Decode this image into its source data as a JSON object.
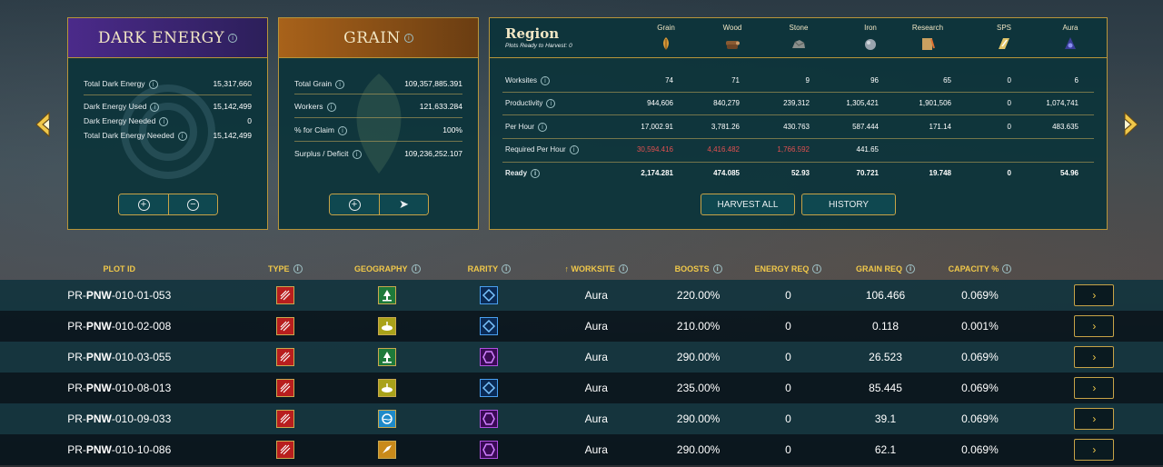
{
  "dark_energy": {
    "title": "DARK ENERGY",
    "rows": [
      {
        "label": "Total Dark Energy",
        "value": "15,317,660"
      },
      {
        "label": "Dark Energy Used",
        "value": "15,142,499"
      },
      {
        "label": "Dark Energy Needed",
        "value": "0"
      },
      {
        "label": "Total Dark Energy Needed",
        "value": "15,142,499"
      }
    ],
    "buttons": {
      "add": "+",
      "remove": "−"
    }
  },
  "grain": {
    "title": "GRAIN",
    "rows": [
      {
        "label": "Total Grain",
        "value": "109,357,885.391"
      },
      {
        "label": "Workers",
        "value": "121,633.284"
      },
      {
        "label": "% for Claim",
        "value": "100%"
      },
      {
        "label": "Surplus / Deficit",
        "value": "109,236,252.107"
      }
    ],
    "buttons": {
      "add": "+",
      "send": "➤"
    }
  },
  "region": {
    "title": "Region",
    "subtitle": "Plots Ready to Harvest: 0",
    "columns": [
      {
        "name": "Grain",
        "icon": "grain-icon",
        "color": "#d89a3a"
      },
      {
        "name": "Wood",
        "icon": "wood-icon",
        "color": "#8a5a32"
      },
      {
        "name": "Stone",
        "icon": "stone-icon",
        "color": "#8a8f8c"
      },
      {
        "name": "Iron",
        "icon": "iron-icon",
        "color": "#9aa4ae"
      },
      {
        "name": "Research",
        "icon": "research-icon",
        "color": "#c9a060"
      },
      {
        "name": "SPS",
        "icon": "sps-icon",
        "color": "#e2c66a"
      },
      {
        "name": "Aura",
        "icon": "aura-icon",
        "color": "#3b3f9a"
      }
    ],
    "rows": [
      {
        "label": "Worksites",
        "values": [
          "74",
          "71",
          "9",
          "96",
          "65",
          "0",
          "6"
        ]
      },
      {
        "label": "Productivity",
        "values": [
          "944,606",
          "840,279",
          "239,312",
          "1,305,421",
          "1,901,506",
          "0",
          "1,074,741"
        ]
      },
      {
        "label": "Per Hour",
        "values": [
          "17,002.91",
          "3,781.26",
          "430.763",
          "587.444",
          "171.14",
          "0",
          "483.635"
        ]
      },
      {
        "label": "Required Per Hour",
        "values": [
          "30,594.416",
          "4,416.482",
          "1,766.592",
          "441.65",
          "",
          "",
          ""
        ]
      },
      {
        "label": "Ready",
        "values": [
          "2,174.281",
          "474.085",
          "52.93",
          "70.721",
          "19.748",
          "0",
          "54.96"
        ]
      }
    ],
    "harvest_all": "HARVEST ALL",
    "history": "HISTORY"
  },
  "table": {
    "headers": [
      "PLOT ID",
      "TYPE",
      "GEOGRAPHY",
      "RARITY",
      "WORKSITE",
      "BOOSTS",
      "ENERGY REQ",
      "GRAIN REQ",
      "CAPACITY %"
    ],
    "sort_indicator": "↑",
    "rows": [
      {
        "prefix": "PR-",
        "region": "PNW",
        "suffix": "-010-01-053",
        "type": "red",
        "geo": "forest",
        "rarity": "blue",
        "worksite": "Aura",
        "boosts": "220.00%",
        "energy": "0",
        "grain": "106.466",
        "capacity": "0.069%"
      },
      {
        "prefix": "PR-",
        "region": "PNW",
        "suffix": "-010-02-008",
        "type": "red",
        "geo": "bog",
        "rarity": "blue",
        "worksite": "Aura",
        "boosts": "210.00%",
        "energy": "0",
        "grain": "0.118",
        "capacity": "0.001%"
      },
      {
        "prefix": "PR-",
        "region": "PNW",
        "suffix": "-010-03-055",
        "type": "red",
        "geo": "forest",
        "rarity": "purple",
        "worksite": "Aura",
        "boosts": "290.00%",
        "energy": "0",
        "grain": "26.523",
        "capacity": "0.069%"
      },
      {
        "prefix": "PR-",
        "region": "PNW",
        "suffix": "-010-08-013",
        "type": "red",
        "geo": "bog",
        "rarity": "blue",
        "worksite": "Aura",
        "boosts": "235.00%",
        "energy": "0",
        "grain": "85.445",
        "capacity": "0.069%"
      },
      {
        "prefix": "PR-",
        "region": "PNW",
        "suffix": "-010-09-033",
        "type": "red",
        "geo": "water",
        "rarity": "purple",
        "worksite": "Aura",
        "boosts": "290.00%",
        "energy": "0",
        "grain": "39.1",
        "capacity": "0.069%"
      },
      {
        "prefix": "PR-",
        "region": "PNW",
        "suffix": "-010-10-086",
        "type": "red",
        "geo": "badlands",
        "rarity": "purple",
        "worksite": "Aura",
        "boosts": "290.00%",
        "energy": "0",
        "grain": "62.1",
        "capacity": "0.069%"
      }
    ],
    "row_action": "›"
  }
}
